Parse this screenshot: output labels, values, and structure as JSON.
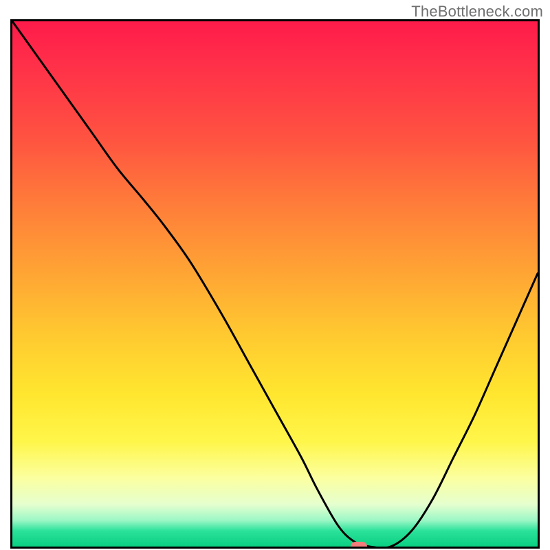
{
  "watermark": "TheBottleneck.com",
  "chart_data": {
    "type": "line",
    "title": "",
    "xlabel": "",
    "ylabel": "",
    "xlim": [
      0,
      100
    ],
    "ylim": [
      0,
      100
    ],
    "grid": false,
    "legend": false,
    "series": [
      {
        "name": "bottleneck-curve",
        "x": [
          0,
          5,
          10,
          15,
          20,
          25,
          29,
          34,
          40,
          45,
          50,
          55,
          58,
          62,
          65,
          68,
          72,
          76,
          80,
          84,
          88,
          92,
          96,
          100
        ],
        "y": [
          100,
          93,
          86,
          79,
          72,
          66,
          61,
          54,
          44,
          35,
          26,
          17,
          11,
          4,
          1,
          0,
          0,
          3,
          9,
          17,
          25,
          34,
          43,
          52
        ]
      }
    ],
    "marker": {
      "x": 66,
      "y": 0
    },
    "background_gradient_stops": [
      {
        "pos": 0,
        "color": "#ff1b4a"
      },
      {
        "pos": 22,
        "color": "#ff5241"
      },
      {
        "pos": 48,
        "color": "#ffa534"
      },
      {
        "pos": 71,
        "color": "#ffe62f"
      },
      {
        "pos": 92,
        "color": "#e5ffcf"
      },
      {
        "pos": 100,
        "color": "#0ad082"
      }
    ]
  }
}
